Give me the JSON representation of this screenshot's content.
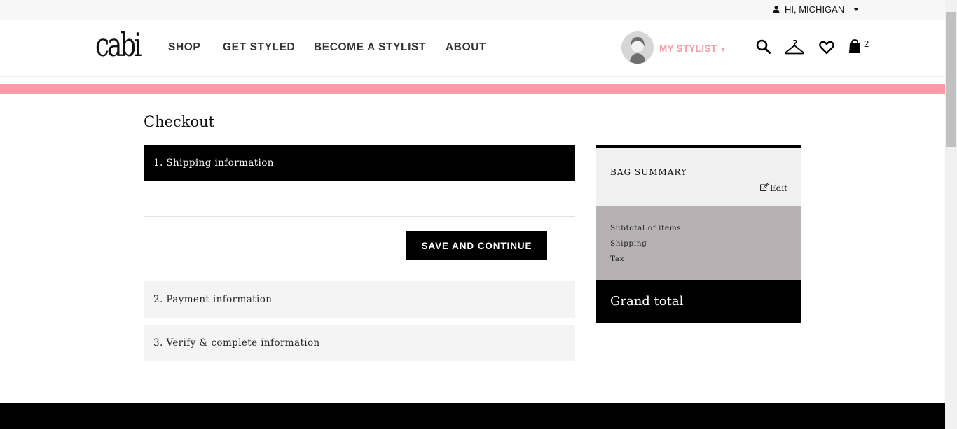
{
  "topbar": {
    "greeting": "HI, MICHIGAN"
  },
  "header": {
    "logo_text": "cabi",
    "nav": [
      "SHOP",
      "GET STYLED",
      "BECOME A STYLIST",
      "ABOUT"
    ],
    "stylist_label": "MY STYLIST",
    "bag_count": "2",
    "accent_color": "#f3a0ae",
    "banner_color": "#ff9aa6"
  },
  "checkout": {
    "title": "Checkout",
    "steps": [
      {
        "label": "1. Shipping information"
      },
      {
        "label": "2. Payment information"
      },
      {
        "label": "3. Verify & complete information"
      }
    ],
    "save_label": "SAVE AND CONTINUE"
  },
  "summary": {
    "title": "BAG SUMMARY",
    "edit_label": "Edit",
    "lines": [
      "Subtotal of items",
      "Shipping",
      "Tax"
    ],
    "grand_total_label": "Grand total"
  }
}
